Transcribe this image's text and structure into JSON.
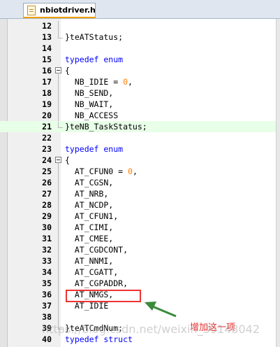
{
  "tab": {
    "label": "nbiotdriver.h"
  },
  "lines": [
    {
      "no": "12",
      "fold": "v",
      "code": []
    },
    {
      "no": "13",
      "fold": "end",
      "code": [
        [
          "t",
          "}teATStatus;"
        ]
      ]
    },
    {
      "no": "14",
      "fold": "",
      "code": []
    },
    {
      "no": "15",
      "fold": "",
      "code": [
        [
          "k",
          "typedef enum"
        ]
      ]
    },
    {
      "no": "16",
      "fold": "open",
      "code": [
        [
          "t",
          "{"
        ]
      ]
    },
    {
      "no": "17",
      "fold": "v",
      "code": [
        [
          "t",
          "  NB_IDIE = "
        ],
        [
          "n",
          "0"
        ],
        [
          "t",
          ","
        ]
      ]
    },
    {
      "no": "18",
      "fold": "v",
      "code": [
        [
          "t",
          "  NB_SEND,"
        ]
      ]
    },
    {
      "no": "19",
      "fold": "v",
      "code": [
        [
          "t",
          "  NB_WAIT,"
        ]
      ]
    },
    {
      "no": "20",
      "fold": "v",
      "code": [
        [
          "t",
          "  NB_ACCESS"
        ]
      ]
    },
    {
      "no": "21",
      "fold": "end",
      "hl": true,
      "code": [
        [
          "t",
          "}teNB_TaskStatus;"
        ]
      ]
    },
    {
      "no": "22",
      "fold": "",
      "code": []
    },
    {
      "no": "23",
      "fold": "",
      "code": [
        [
          "k",
          "typedef enum"
        ]
      ]
    },
    {
      "no": "24",
      "fold": "open",
      "code": [
        [
          "t",
          "{"
        ]
      ]
    },
    {
      "no": "25",
      "fold": "v",
      "code": [
        [
          "t",
          "  AT_CFUN0 = "
        ],
        [
          "n",
          "0"
        ],
        [
          "t",
          ","
        ]
      ]
    },
    {
      "no": "26",
      "fold": "v",
      "code": [
        [
          "t",
          "  AT_CGSN,"
        ]
      ]
    },
    {
      "no": "27",
      "fold": "v",
      "code": [
        [
          "t",
          "  AT_NRB,"
        ]
      ]
    },
    {
      "no": "28",
      "fold": "v",
      "code": [
        [
          "t",
          "  AT_NCDP,"
        ]
      ]
    },
    {
      "no": "29",
      "fold": "v",
      "code": [
        [
          "t",
          "  AT_CFUN1,"
        ]
      ]
    },
    {
      "no": "30",
      "fold": "v",
      "code": [
        [
          "t",
          "  AT_CIMI,"
        ]
      ]
    },
    {
      "no": "31",
      "fold": "v",
      "code": [
        [
          "t",
          "  AT_CMEE,"
        ]
      ]
    },
    {
      "no": "32",
      "fold": "v",
      "code": [
        [
          "t",
          "  AT_CGDCONT,"
        ]
      ]
    },
    {
      "no": "33",
      "fold": "v",
      "code": [
        [
          "t",
          "  AT_NNMI,"
        ]
      ]
    },
    {
      "no": "34",
      "fold": "v",
      "code": [
        [
          "t",
          "  AT_CGATT,"
        ]
      ]
    },
    {
      "no": "35",
      "fold": "v",
      "code": [
        [
          "t",
          "  AT_CGPADDR,"
        ]
      ]
    },
    {
      "no": "36",
      "fold": "v",
      "code": [
        [
          "t",
          "  AT_NMGS,"
        ]
      ]
    },
    {
      "no": "37",
      "fold": "v",
      "code": [
        [
          "t",
          "  AT_IDIE"
        ]
      ]
    },
    {
      "no": "38",
      "fold": "v",
      "code": []
    },
    {
      "no": "39",
      "fold": "end",
      "code": [
        [
          "t",
          "}teATCmdNum;"
        ]
      ]
    },
    {
      "no": "40",
      "fold": "",
      "code": [
        [
          "k",
          "typedef struct"
        ]
      ]
    }
  ],
  "annotation": {
    "text": "增加这一项"
  },
  "watermark": {
    "text": "https://blog.csdn.net/weixin_39148042"
  },
  "colors": {
    "keyword": "#0000ff",
    "number": "#ff8000",
    "highlight": "#e8ffe8",
    "annotation": "#e33333",
    "arrow": "#3a8a3a"
  }
}
